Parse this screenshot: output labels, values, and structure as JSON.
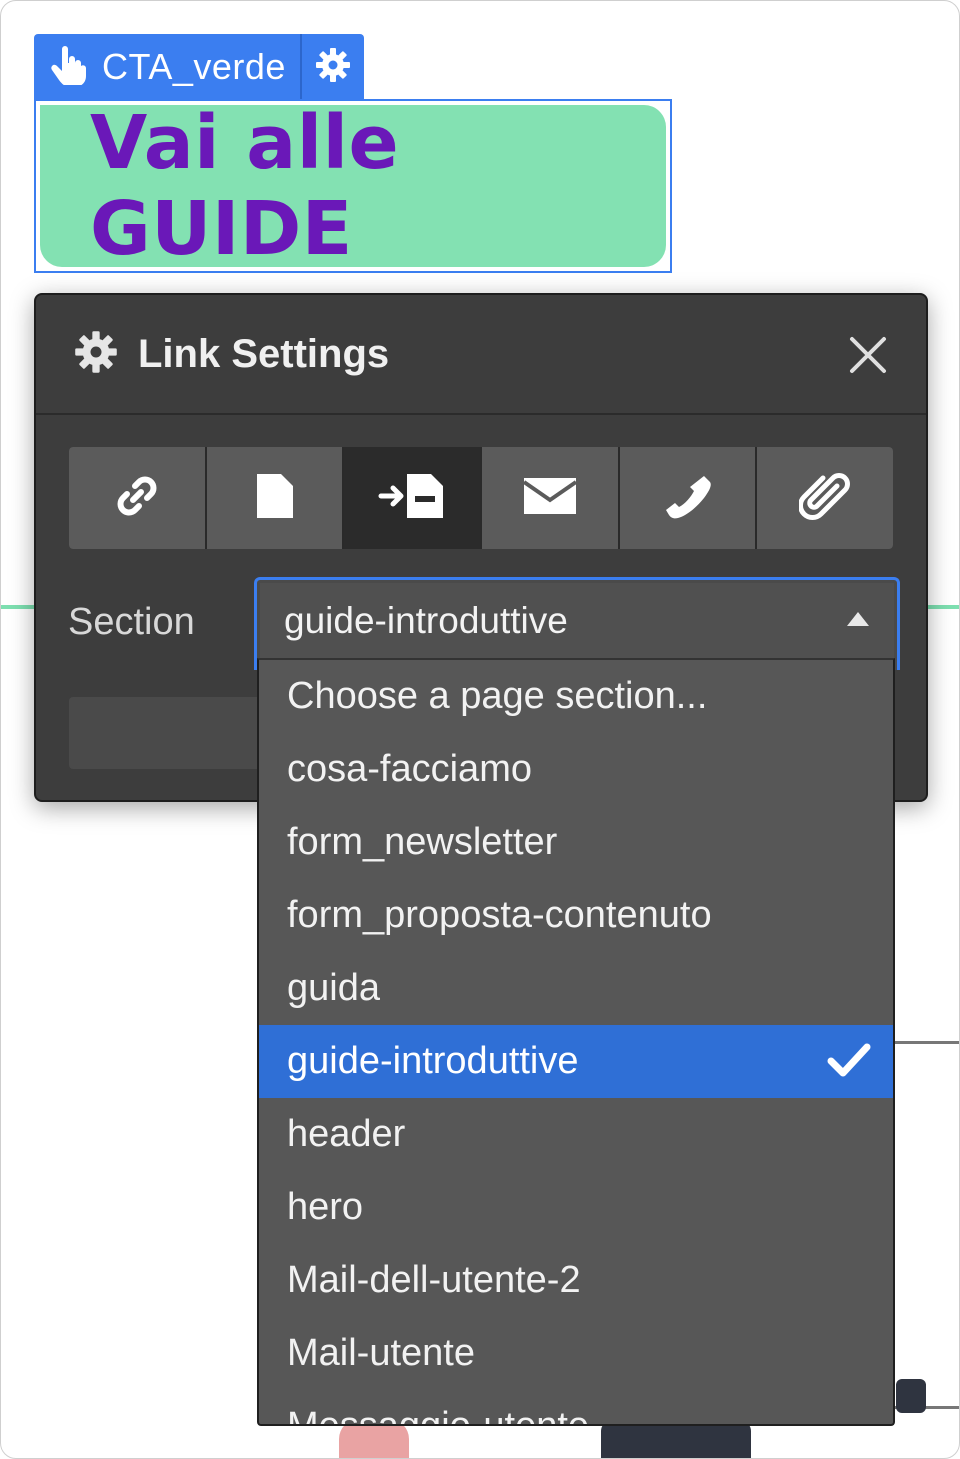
{
  "element_tag": {
    "label": "CTA_verde",
    "hand_icon": "hand-pointer-icon",
    "settings_icon": "gear-icon"
  },
  "cta": {
    "text": "Vai alle GUIDE",
    "background": "#83e1b2",
    "text_color": "#6a18b8"
  },
  "dialog": {
    "title": "Link Settings",
    "title_icon": "gear-icon",
    "close_icon": "close-icon",
    "tabs": [
      {
        "name": "url",
        "icon": "link-icon",
        "active": false
      },
      {
        "name": "page",
        "icon": "page-icon",
        "active": false
      },
      {
        "name": "section",
        "icon": "page-section-icon",
        "active": true
      },
      {
        "name": "email",
        "icon": "envelope-icon",
        "active": false
      },
      {
        "name": "phone",
        "icon": "phone-icon",
        "active": false
      },
      {
        "name": "asset",
        "icon": "paperclip-icon",
        "active": false
      }
    ],
    "section_label": "Section",
    "selected_value": "guide-introduttive"
  },
  "dropdown": {
    "options": [
      {
        "label": "Choose a page section...",
        "selected": false
      },
      {
        "label": "cosa-facciamo",
        "selected": false
      },
      {
        "label": "form_newsletter",
        "selected": false
      },
      {
        "label": "form_proposta-contenuto",
        "selected": false
      },
      {
        "label": "guida",
        "selected": false
      },
      {
        "label": "guide-introduttive",
        "selected": true
      },
      {
        "label": "header",
        "selected": false
      },
      {
        "label": "hero",
        "selected": false
      },
      {
        "label": "Mail-dell-utente-2",
        "selected": false
      },
      {
        "label": "Mail-utente",
        "selected": false
      },
      {
        "label": "Messaggio-utente",
        "selected": false
      }
    ]
  },
  "colors": {
    "accent": "#3b7ef0",
    "panel": "#3d3d3d",
    "selected_row": "#2f6fd6"
  }
}
